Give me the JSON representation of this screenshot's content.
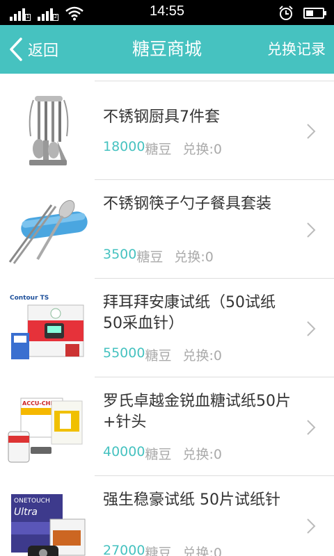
{
  "status_bar": {
    "time": "14:55",
    "sim1": "1",
    "sim2": "2"
  },
  "header": {
    "back_label": "返回",
    "title": "糖豆商城",
    "record_label": "兑换记录"
  },
  "colors": {
    "accent": "#46c2c0",
    "text": "#333333",
    "muted": "#aaaaaa"
  },
  "items": [
    {
      "name": "不锈钢厨具7件套",
      "price": "18000",
      "unit": "糖豆",
      "exchange": "兑换:0",
      "thumb_icon": "kitchen-utensil-set-icon"
    },
    {
      "name": "不锈钢筷子勺子餐具套装",
      "price": "3500",
      "unit": "糖豆",
      "exchange": "兑换:0",
      "thumb_icon": "chopsticks-spoon-set-icon"
    },
    {
      "name": "拜耳拜安康试纸（50试纸 50采血针）",
      "price": "55000",
      "unit": "糖豆",
      "exchange": "兑换:0",
      "thumb_icon": "contour-ts-test-strips-box-icon",
      "brand": "Contour TS"
    },
    {
      "name": "罗氏卓越金锐血糖试纸50片+针头",
      "price": "40000",
      "unit": "糖豆",
      "exchange": "兑换:0",
      "thumb_icon": "accu-chek-test-strips-box-icon",
      "brand": "ACCU-CHEK"
    },
    {
      "name": "强生稳豪试纸 50片试纸针",
      "price": "27000",
      "unit": "糖豆",
      "exchange": "兑换:0",
      "thumb_icon": "onetouch-ultra-test-strips-box-icon",
      "brand": "OneTouch Ultra"
    }
  ]
}
